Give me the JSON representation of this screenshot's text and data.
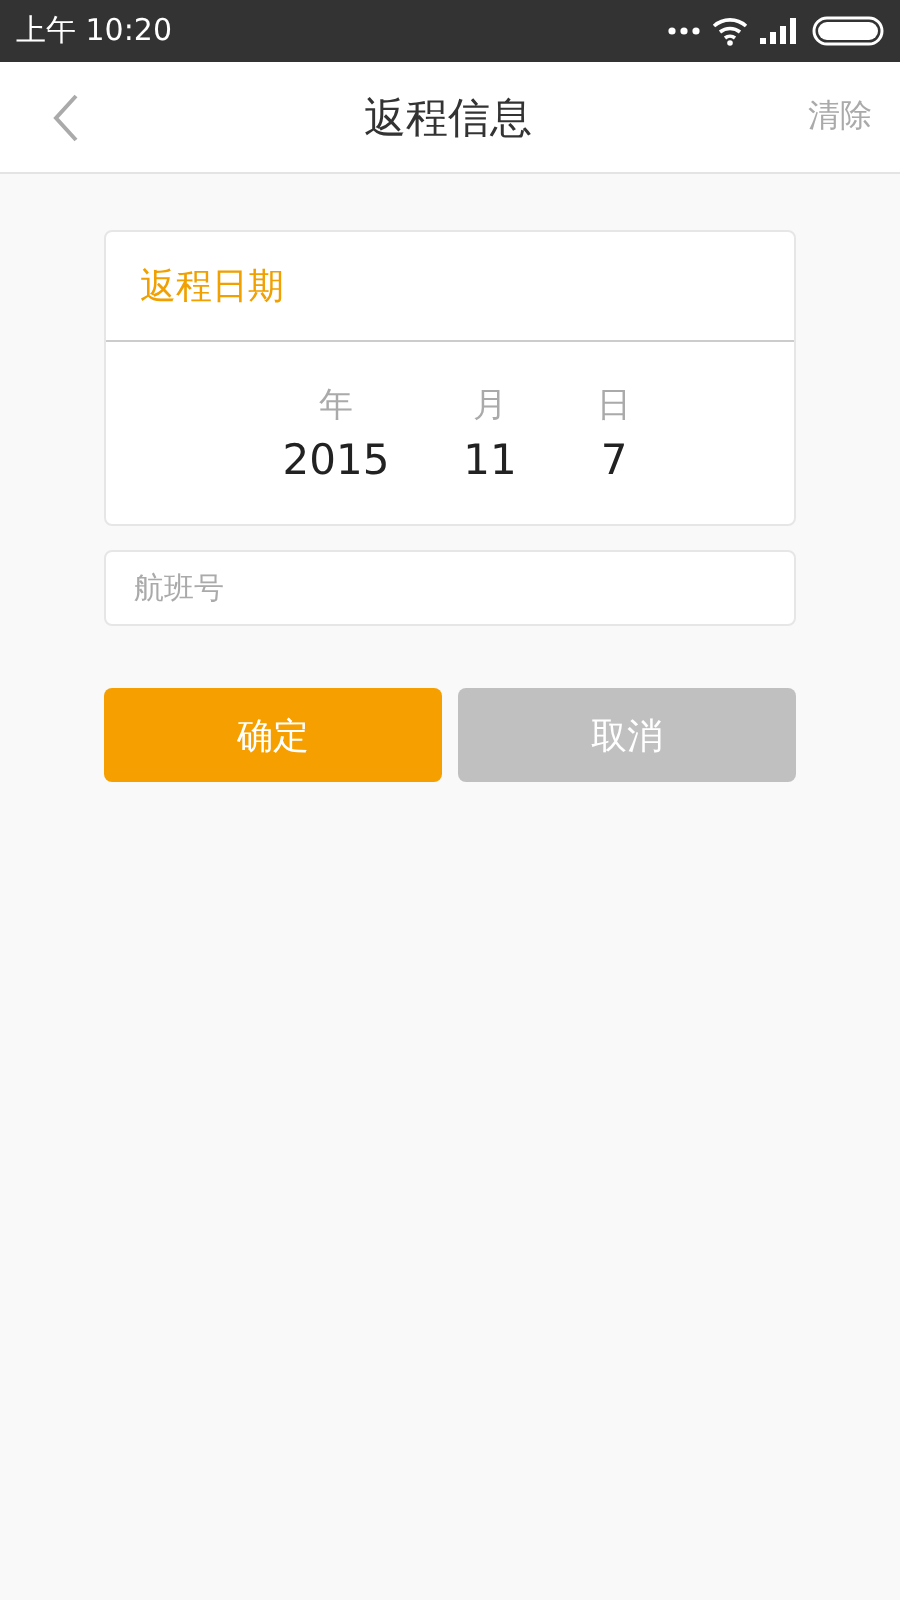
{
  "status_bar": {
    "time": "上午 10:20"
  },
  "nav": {
    "title": "返程信息",
    "action": "清除"
  },
  "date_card": {
    "title": "返程日期",
    "columns": [
      {
        "label": "年",
        "value": "2015"
      },
      {
        "label": "月",
        "value": "11"
      },
      {
        "label": "日",
        "value": "7"
      }
    ]
  },
  "flight_field": {
    "placeholder": "航班号"
  },
  "buttons": [
    {
      "label": "确定",
      "kind": "primary"
    },
    {
      "label": "取消",
      "kind": "secondary"
    }
  ]
}
